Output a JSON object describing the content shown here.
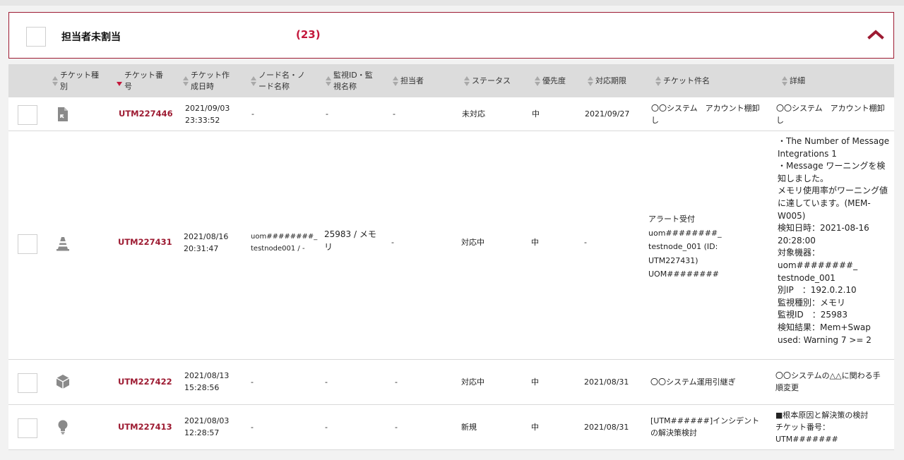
{
  "group": {
    "title": "担当者未割当",
    "count": "(23)"
  },
  "columns": [
    {
      "label": "チケット種\n別",
      "sort": "none"
    },
    {
      "label": "チケット番\n号",
      "sort": "desc"
    },
    {
      "label": "チケット作\n成日時",
      "sort": "none"
    },
    {
      "label": "ノード名・ノ\nード名称",
      "sort": "none"
    },
    {
      "label": "監視ID・監\n視名称",
      "sort": "none"
    },
    {
      "label": "担当者",
      "sort": "none"
    },
    {
      "label": "ステータス",
      "sort": "none"
    },
    {
      "label": "優先度",
      "sort": "none"
    },
    {
      "label": "対応期限",
      "sort": "none"
    },
    {
      "label": "チケット件名",
      "sort": "none"
    },
    {
      "label": "詳細",
      "sort": "none"
    }
  ],
  "rows": [
    {
      "type_icon": "document-arrow-icon",
      "ticket_no": "UTM227446",
      "created": "2021/09/03\n23:33:52",
      "node": "-",
      "monitor": "-",
      "assignee": "-",
      "status": "未対応",
      "priority": "中",
      "due": "2021/09/27",
      "subject": "〇〇システム　アカウント棚卸\nし",
      "detail": "〇〇システム　アカウント棚卸\nし"
    },
    {
      "type_icon": "traffic-cone-icon",
      "ticket_no": "UTM227431",
      "created": "2021/08/16\n20:31:47",
      "node": "uom########_\ntestnode001 / -",
      "monitor": "25983 / メモ\nリ",
      "assignee": "-",
      "status": "対応中",
      "priority": "中",
      "due": "-",
      "subject": "アラート受付\nuom########_\ntestnode_001 (ID:\nUTM227431)\nUOM########",
      "detail": "・The Number of Message\nIntegrations 1\n・Message ワーニングを検\n知しました。\nメモリ使用率がワーニング値\nに達しています。(MEM-\nW005)\n検知日時：2021-08-16\n20:28:00\n対象機器：\nuom########_\ntestnode_001\n別IP　：192.0.2.10\n監視種別：メモリ\n監視ID　：25983\n検知結果：Mem+Swap\nused: Warning 7 >= 2"
    },
    {
      "type_icon": "package-box-icon",
      "ticket_no": "UTM227422",
      "created": "2021/08/13\n15:28:56",
      "node": "-",
      "monitor": "-",
      "assignee": "-",
      "status": "対応中",
      "priority": "中",
      "due": "2021/08/31",
      "subject": "〇〇システム運用引継ぎ",
      "detail": "〇〇システムの△△に関わる手\n順変更"
    },
    {
      "type_icon": "lightbulb-icon",
      "ticket_no": "UTM227413",
      "created": "2021/08/03\n12:28:57",
      "node": "-",
      "monitor": "-",
      "assignee": "-",
      "status": "新規",
      "priority": "中",
      "due": "2021/08/31",
      "subject": "[UTM######]インシデント\nの解決策検討",
      "detail": "■根本原因と解決策の検討\nチケット番号：\nUTM#######"
    }
  ],
  "colors": {
    "accent": "#9d1b32",
    "count": "#c3183b",
    "header_bg": "#dcdcdc"
  }
}
